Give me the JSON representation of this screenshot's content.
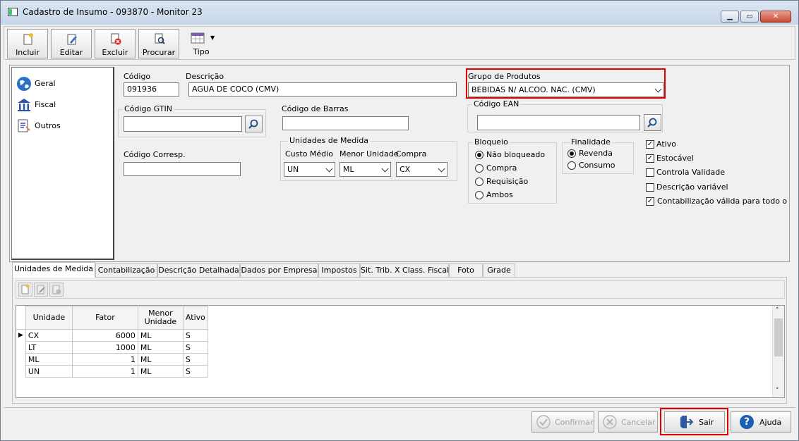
{
  "window": {
    "title": "Cadastro de Insumo - 093870 - Monitor 23"
  },
  "toolbar": {
    "incluir": "Incluir",
    "editar": "Editar",
    "excluir": "Excluir",
    "procurar": "Procurar",
    "tipo": "Tipo"
  },
  "nav": {
    "items": [
      {
        "label": "Geral"
      },
      {
        "label": "Fiscal"
      },
      {
        "label": "Outros"
      }
    ]
  },
  "form": {
    "codigo_label": "Código",
    "codigo_value": "091936",
    "descricao_label": "Descrição",
    "descricao_value": "AGUA DE COCO (CMV)",
    "grupo_label": "Grupo de Produtos",
    "grupo_value": "BEBIDAS N/ ALCOO. NAC. (CMV)",
    "gtin_label": "Código GTIN",
    "gtin_value": "",
    "barras_label": "Código de Barras",
    "barras_value": "",
    "ean_label": "Código EAN",
    "ean_value": "",
    "corresp_label": "Código Corresp.",
    "corresp_value": "",
    "unidades": {
      "title": "Unidades de Medida",
      "custo_label": "Custo Médio",
      "custo_value": "UN",
      "menor_label": "Menor Unidade",
      "menor_value": "ML",
      "compra_label": "Compra",
      "compra_value": "CX"
    },
    "bloqueio": {
      "title": "Bloqueio",
      "options": [
        "Não bloqueado",
        "Compra",
        "Requisição",
        "Ambos"
      ],
      "selected": "Não bloqueado"
    },
    "finalidade": {
      "title": "Finalidade",
      "options": [
        "Revenda",
        "Consumo"
      ],
      "selected": "Revenda"
    },
    "checks": [
      {
        "label": "Ativo",
        "checked": true
      },
      {
        "label": "Estocável",
        "checked": true
      },
      {
        "label": "Controla Validade",
        "checked": false
      },
      {
        "label": "Descrição variável",
        "checked": false
      },
      {
        "label": "Contabilização válida para todo o Grupo",
        "checked": true
      }
    ]
  },
  "tabs": [
    "Unidades de Medida",
    "Contabilização",
    "Descrição Detalhada",
    "Dados por Empresa",
    "Impostos",
    "Sit. Trib. X Class. Fiscal",
    "Foto",
    "Grade"
  ],
  "grid": {
    "headers": [
      "Unidade",
      "Fator",
      "Menor Unidade",
      "Ativo"
    ],
    "rows": [
      [
        "CX",
        "6000",
        "ML",
        "S"
      ],
      [
        "LT",
        "1000",
        "ML",
        "S"
      ],
      [
        "ML",
        "1",
        "ML",
        "S"
      ],
      [
        "UN",
        "1",
        "ML",
        "S"
      ]
    ]
  },
  "buttons": {
    "confirmar": "Confirmar",
    "cancelar": "Cancelar",
    "sair": "Sair",
    "ajuda": "Ajuda"
  },
  "colors": {
    "highlight": "#e00000",
    "help": "#1a5fb4"
  }
}
